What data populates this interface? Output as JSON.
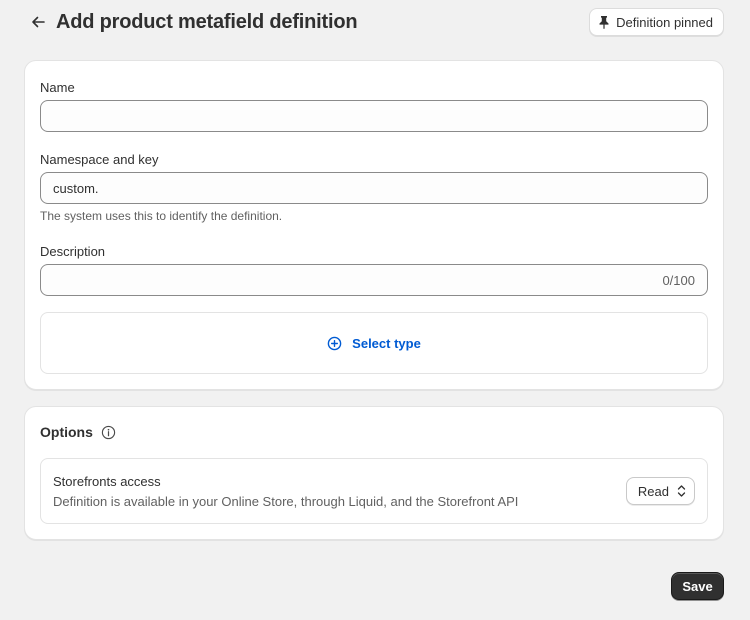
{
  "header": {
    "title": "Add product metafield definition",
    "back_icon": "arrow-left-icon",
    "pin_button_label": "Definition pinned",
    "pin_icon": "pin-icon"
  },
  "form": {
    "name": {
      "label": "Name",
      "value": ""
    },
    "namespace": {
      "label": "Namespace and key",
      "value": "custom.",
      "help": "The system uses this to identify the definition."
    },
    "description": {
      "label": "Description",
      "value": "",
      "counter": "0/100"
    },
    "select_type": {
      "label": "Select type",
      "icon": "plus-circle-icon"
    }
  },
  "options": {
    "title": "Options",
    "info_icon": "info-icon",
    "storefronts": {
      "title": "Storefronts access",
      "description": "Definition is available in your Online Store, through Liquid, and the Storefront API",
      "select_value": "Read",
      "select_icon": "select-chevrons-icon"
    }
  },
  "footer": {
    "save_label": "Save"
  },
  "colors": {
    "accent": "#005bd3",
    "primary_button": "#303030",
    "background": "#f1f1f1"
  }
}
